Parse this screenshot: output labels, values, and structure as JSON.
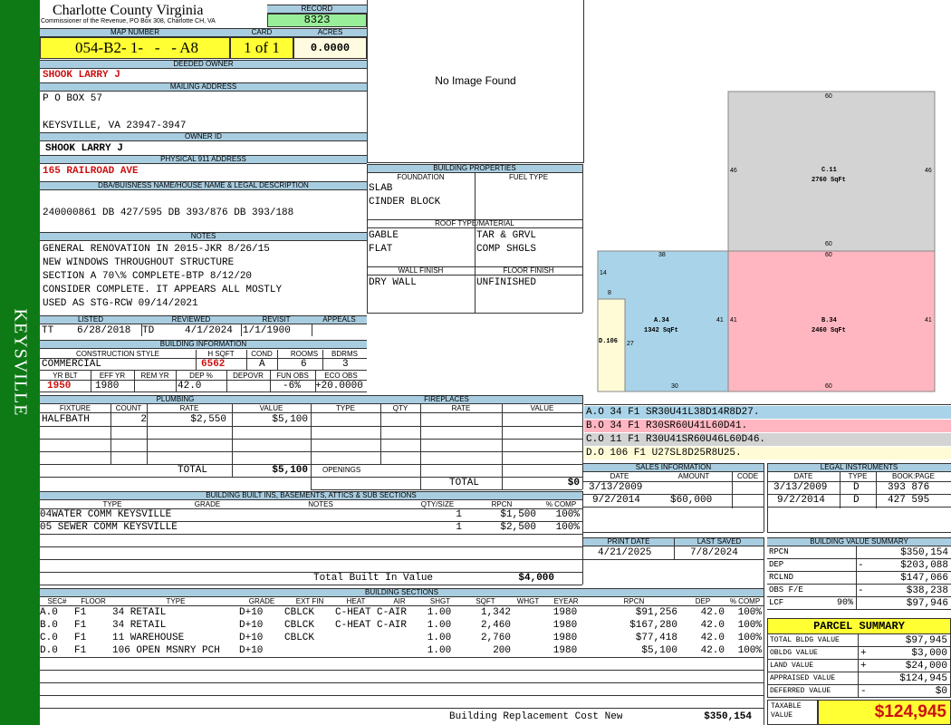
{
  "county": {
    "name": "Charlotte County Virginia",
    "sub": "Commissioner of the Revenue, PO Box 308, Charlotte CH, VA"
  },
  "side_text": "KEYSVILLE",
  "record": {
    "label": "RECORD",
    "value": "8323"
  },
  "map": {
    "label": "MAP NUMBER",
    "value": "054-B2- 1-   -   - A8"
  },
  "card": {
    "label": "CARD",
    "value": "1 of 1"
  },
  "acres": {
    "label": "ACRES",
    "value": "0.0000"
  },
  "owner": {
    "label": "DEEDED OWNER",
    "value": "SHOOK LARRY J"
  },
  "mailing": {
    "label": "MAILING ADDRESS",
    "line1": "P O BOX 57",
    "line2": "KEYSVILLE, VA 23947-3947"
  },
  "owner_id": {
    "label": "OWNER ID",
    "value": "SHOOK LARRY J"
  },
  "physical": {
    "label": "PHYSICAL 911 ADDRESS",
    "value": "165 RAILROAD AVE"
  },
  "dba": {
    "label": "DBA/BUISNESS NAME/HOUSE NAME & LEGAL DESCRIPTION",
    "value": "240000861 DB 427/595 DB 393/876 DB 393/188"
  },
  "notes": {
    "label": "NOTES",
    "lines": [
      "GENERAL RENOVATION IN 2015-JKR 8/26/15",
      "NEW WINDOWS THROUGHOUT STRUCTURE",
      "SECTION A 70\\% COMPLETE-BTP 8/12/20",
      "CONSIDER COMPLETE. IT APPEARS ALL MOSTLY",
      "USED AS STG-RCW 09/14/2021"
    ]
  },
  "listed": {
    "label": "LISTED",
    "code": "TT",
    "date": "6/28/2018"
  },
  "reviewed": {
    "label": "REVIEWED",
    "code": "TD",
    "date": "4/1/2024"
  },
  "revisit": {
    "label": "REVISIT",
    "date": "1/1/1900"
  },
  "appeals": {
    "label": "APPEALS",
    "value": ""
  },
  "bldg_info": {
    "label": "BUILDING INFORMATION",
    "h_style": "CONSTRUCTION STYLE",
    "h_hsqft": "H SQFT",
    "h_cond": "COND",
    "h_rooms": "ROOMS",
    "h_bdrms": "BDRMS",
    "style": "COMMERCIAL",
    "hsqft": "6562",
    "cond": "A",
    "rooms": "6",
    "bdrms": "3",
    "h_yrblt": "YR BLT",
    "h_effyr": "EFF YR",
    "h_remyr": "REM YR",
    "h_dep": "DEP %",
    "h_depovr": "DEPOVR",
    "h_funobs": "FUN OBS",
    "h_ecoobs": "ECO OBS",
    "yrblt": "1950",
    "effyr": "1980",
    "remyr": "",
    "dep": "42.0",
    "depovr": "",
    "funobs": "-6%",
    "ecoobs": "+20.0000"
  },
  "no_image": "No Image Found",
  "bldg_props": {
    "label": "BUILDING PROPERTIES",
    "foundation_label": "FOUNDATION",
    "fuel_label": "FUEL TYPE",
    "foundation": [
      "SLAB",
      "CINDER BLOCK"
    ],
    "roof_label": "ROOF TYPE/MATERIAL",
    "roof_left": [
      "GABLE",
      "FLAT"
    ],
    "roof_right": [
      "TAR & GRVL",
      "COMP SHGLS"
    ],
    "wall_label": "WALL FINISH",
    "floor_label": "FLOOR FINISH",
    "wall": "DRY WALL",
    "floor": "UNFINISHED"
  },
  "sketch": {
    "c_label": "C.11",
    "c_area": "2760 SqFt",
    "b_label": "B.34",
    "b_area": "2460 SqFt",
    "a_label": "A.34",
    "a_area": "1342 SqFt",
    "d_label": "D.106",
    "dims": [
      "60",
      "46",
      "46",
      "60",
      "60",
      "41",
      "41",
      "38",
      "14",
      "8",
      "41",
      "27",
      "30",
      "60"
    ]
  },
  "sketch_codes": [
    {
      "text": "A.O  34   F1  SR30U41L38D14R8D27.",
      "color": "#a9d3e8"
    },
    {
      "text": "B.O  34   F1  R30SR60U41L60D41.",
      "color": "#ffb6c1"
    },
    {
      "text": "C.O  11   F1  R30U41SR60U46L60D46.",
      "color": "#d3d3d3"
    },
    {
      "text": "D.O  106  F1  U27SL8D25R8U25.",
      "color": "#fffbd6"
    }
  ],
  "plumbing": {
    "label": "PLUMBING",
    "h_fixture": "FIXTURE",
    "h_count": "COUNT",
    "h_rate": "RATE",
    "h_value": "VALUE",
    "rows": [
      {
        "fixture": "HALFBATH",
        "count": "2",
        "rate": "$2,550",
        "value": "$5,100"
      }
    ],
    "total_label": "TOTAL",
    "total": "$5,100"
  },
  "fireplaces": {
    "label": "FIREPLACES",
    "h_type": "TYPE",
    "h_qty": "QTY",
    "h_rate": "RATE",
    "h_value": "VALUE",
    "openings": "OPENINGS",
    "total_label": "TOTAL",
    "total": "$0"
  },
  "sales": {
    "label": "SALES INFORMATION",
    "h_date": "DATE",
    "h_amount": "AMOUNT",
    "h_code": "CODE",
    "rows": [
      {
        "date": "3/13/2009",
        "amount": "",
        "code": ""
      },
      {
        "date": "9/2/2014",
        "amount": "$60,000",
        "code": ""
      }
    ]
  },
  "legal": {
    "label": "LEGAL INSTRUMENTS",
    "h_date": "DATE",
    "h_type": "TYPE",
    "h_book": "BOOK:PAGE",
    "rows": [
      {
        "date": "3/13/2009",
        "type": "D",
        "book": "393 876"
      },
      {
        "date": "9/2/2014",
        "type": "D",
        "book": "427 595"
      }
    ]
  },
  "print": {
    "label": "PRINT DATE",
    "value": "4/21/2025"
  },
  "saved": {
    "label": "LAST SAVED",
    "value": "7/8/2024"
  },
  "builtins": {
    "label": "BUILDING BUILT INS, BASEMENTS, ATTICS & SUB SECTIONS",
    "h_type": "TYPE",
    "h_grade": "GRADE",
    "h_notes": "NOTES",
    "h_qty": "QTY/SIZE",
    "h_rpcn": "RPCN",
    "h_comp": "% COMP",
    "rows": [
      {
        "type": "04WATER COMM KEYSVILLE",
        "qty": "1",
        "rpcn": "$1,500",
        "comp": "100%"
      },
      {
        "type": "05 SEWER COMM KEYSVILLE",
        "qty": "1",
        "rpcn": "$2,500",
        "comp": "100%"
      }
    ],
    "total_label": "Total Built In Value",
    "total": "$4,000"
  },
  "sections": {
    "label": "BUILDING SECTIONS",
    "headers": [
      "SEC#",
      "FLOOR",
      "TYPE",
      "GRADE",
      "EXT FIN",
      "HEAT",
      "AIR",
      "SHGT",
      "SQFT",
      "WHGT",
      "EYEAR",
      "RPCN",
      "DEP",
      "% COMP"
    ],
    "rows": [
      [
        "A.0",
        "F1",
        "34 RETAIL",
        "D+10",
        "CBLCK",
        "C-HEAT",
        "C-AIR",
        "1.00",
        "1,342",
        "",
        "1980",
        "$91,256",
        "42.0",
        "100%"
      ],
      [
        "B.0",
        "F1",
        "34 RETAIL",
        "D+10",
        "CBLCK",
        "C-HEAT",
        "C-AIR",
        "1.00",
        "2,460",
        "",
        "1980",
        "$167,280",
        "42.0",
        "100%"
      ],
      [
        "C.0",
        "F1",
        "11 WAREHOUSE",
        "D+10",
        "CBLCK",
        "",
        "",
        "1.00",
        "2,760",
        "",
        "1980",
        "$77,418",
        "42.0",
        "100%"
      ],
      [
        "D.0",
        "F1",
        "106 OPEN MSNRY PCH",
        "D+10",
        "",
        "",
        "",
        "1.00",
        "200",
        "",
        "1980",
        "$5,100",
        "42.0",
        "100%"
      ]
    ],
    "total_label": "Building Replacement Cost New",
    "total": "$350,154"
  },
  "value_summary": {
    "label": "BUILDING VALUE SUMMARY",
    "rows": [
      {
        "label": "RPCN",
        "sign": "",
        "value": "$350,154"
      },
      {
        "label": "DEP",
        "sign": "-",
        "value": "$203,088"
      },
      {
        "label": "RCLND",
        "sign": "",
        "value": "$147,066"
      },
      {
        "label": "OBS F/E",
        "sign": "-",
        "value": "$38,238"
      },
      {
        "label": "LCF",
        "pct": "90%",
        "sign": "",
        "value": "$97,946"
      }
    ]
  },
  "parcel": {
    "label": "PARCEL SUMMARY",
    "rows": [
      {
        "label": "TOTAL BLDG VALUE",
        "sign": "",
        "value": "$97,945"
      },
      {
        "label": "OBLDG VALUE",
        "sign": "+",
        "value": "$3,000"
      },
      {
        "label": "LAND VALUE",
        "sign": "+",
        "value": "$24,000"
      },
      {
        "label": "APPRAISED VALUE",
        "sign": "",
        "value": "$124,945"
      },
      {
        "label": "DEFERRED VALUE",
        "sign": "-",
        "value": "$0"
      }
    ],
    "taxable_label": "TAXABLE VALUE",
    "taxable": "$124,945"
  },
  "colors": {
    "green": "#0e7a16",
    "header": "#a9cde0",
    "yellow": "#ffff33",
    "red": "#cc1111",
    "a_fill": "#a9d3e8",
    "b_fill": "#ffb6c1",
    "c_fill": "#d3d3d3",
    "d_fill": "#fffbd6"
  }
}
